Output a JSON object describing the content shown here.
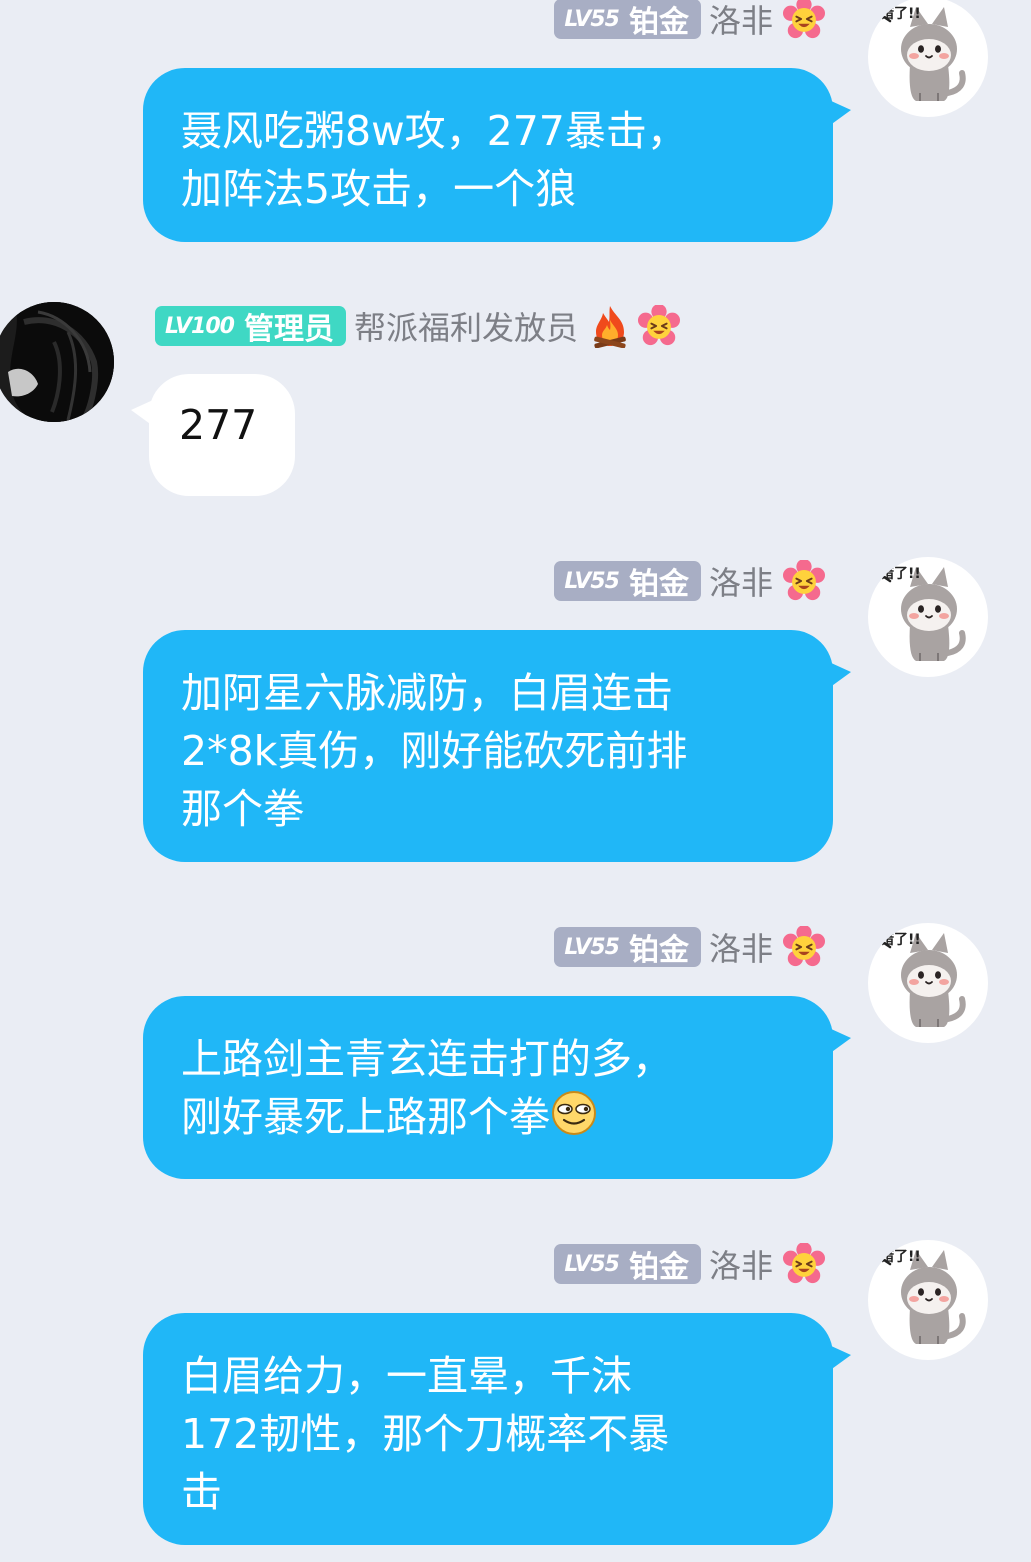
{
  "messages": [
    {
      "side": "right",
      "level": "LV55",
      "title": "铂金",
      "sender": "洛非",
      "avatar_sticker_text": "错了!!",
      "lines": [
        "聂风吃粥8w攻，277暴击，",
        "加阵法5攻击，一个狼"
      ]
    },
    {
      "side": "left",
      "level": "LV100",
      "title": "管理员",
      "sender": "帮派福利发放员",
      "lines": [
        "277"
      ]
    },
    {
      "side": "right",
      "level": "LV55",
      "title": "铂金",
      "sender": "洛非",
      "avatar_sticker_text": "错了!!",
      "lines": [
        "加阿星六脉减防，白眉连击",
        "2*8k真伤，刚好能砍死前排",
        "那个拳"
      ]
    },
    {
      "side": "right",
      "level": "LV55",
      "title": "铂金",
      "sender": "洛非",
      "avatar_sticker_text": "错了!!",
      "lines": [
        "上路剑主青玄连击打的多，",
        "刚好暴死上路那个拳"
      ]
    },
    {
      "side": "right",
      "level": "LV55",
      "title": "铂金",
      "sender": "洛非",
      "avatar_sticker_text": "错了!!",
      "lines": [
        "白眉给力，一直晕，千沫",
        "172韧性，那个刀概率不暴",
        "击"
      ]
    }
  ],
  "colors": {
    "background": "#eaedf4",
    "outgoing_bubble": "#20b7f7",
    "incoming_bubble": "#ffffff",
    "badge_gray": "#a8aec4",
    "badge_teal": "#3fd8c4",
    "sender_name": "#7d7f86"
  },
  "icons": {
    "flower_emoji": "laughing-flower-emoji-icon",
    "fire_emoji": "fire-emoji-icon",
    "smug_face_emoji": "smug-face-emoji-icon",
    "cat_sticker": "crying-cat-sticker-icon",
    "dark_avatar": "dark-haired-figure-avatar"
  }
}
